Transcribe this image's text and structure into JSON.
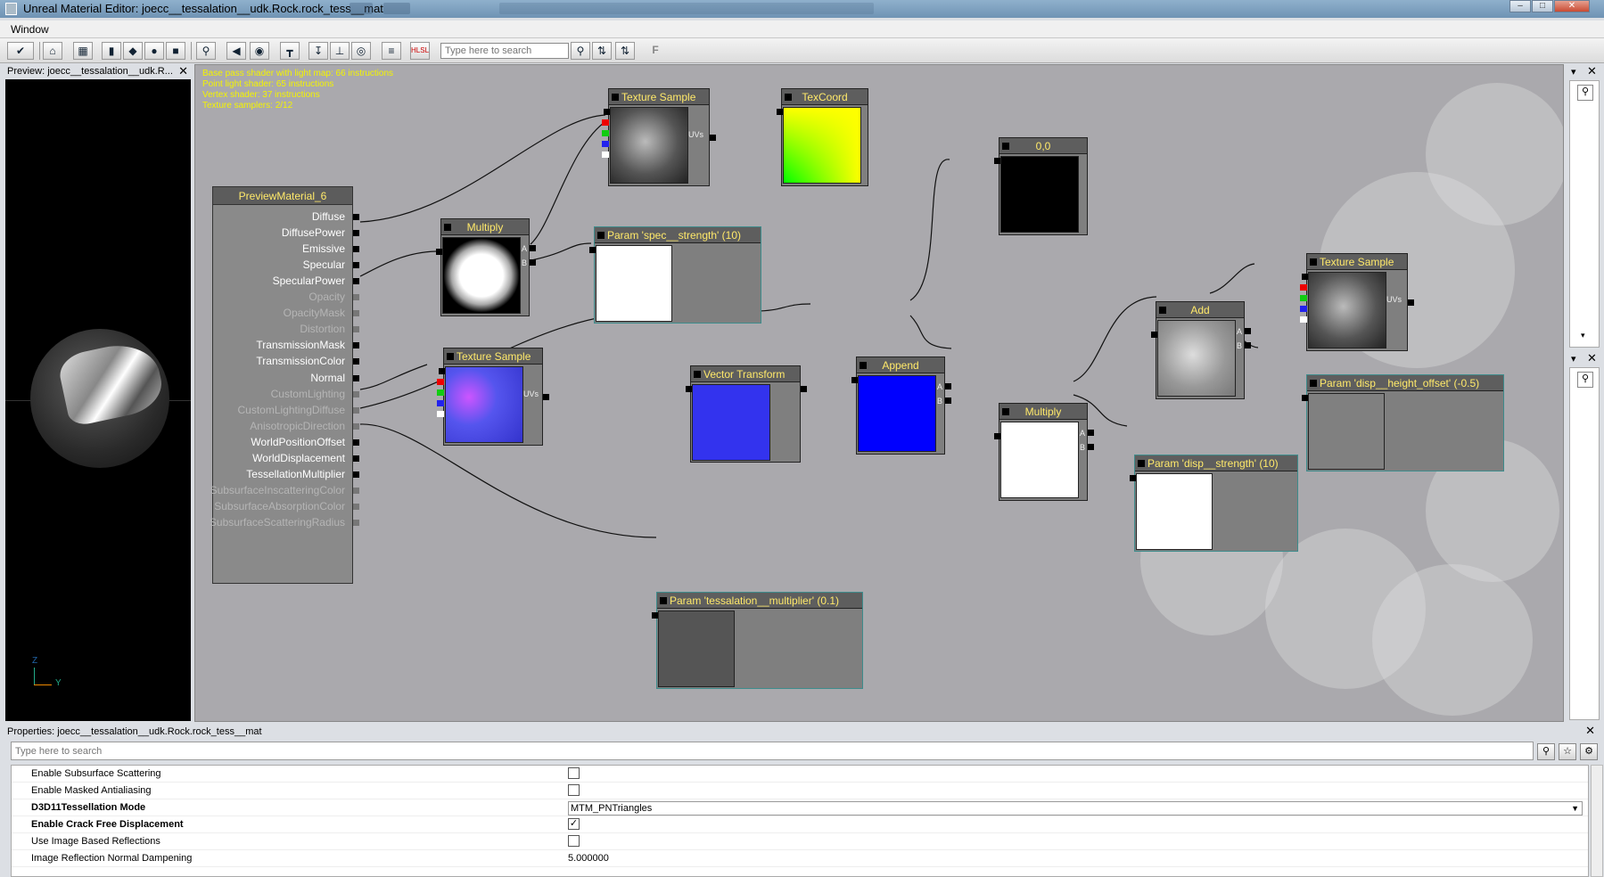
{
  "window": {
    "title": "Unreal Material Editor: joecc__tessalation__udk.Rock.rock_tess__mat",
    "minimize": "–",
    "maximize": "□",
    "close": "✕"
  },
  "menu": {
    "window": "Window"
  },
  "toolbar": {
    "search_placeholder": "Type here to search",
    "icons": [
      "apply",
      "home",
      "grid",
      "cylinder",
      "cube",
      "sphere",
      "plane",
      "zoom",
      "back",
      "realtime",
      "node",
      "stats",
      "fit",
      "clean",
      "hlsl",
      "search-find",
      "search-prev",
      "search-next",
      "font"
    ]
  },
  "preview": {
    "title": "Preview: joecc__tessalation__udk.R...",
    "close": "✕",
    "axis_z": "Z",
    "axis_y": "Y"
  },
  "graph": {
    "stats": [
      "Base pass shader with light map: 66 instructions",
      "Point light shader: 65 instructions",
      "Vertex shader: 37 instructions",
      "Texture samplers: 2/12"
    ],
    "preview_material": {
      "title": "PreviewMaterial_6",
      "inputs": [
        {
          "label": "Diffuse",
          "active": true
        },
        {
          "label": "DiffusePower",
          "active": true
        },
        {
          "label": "Emissive",
          "active": true
        },
        {
          "label": "Specular",
          "active": true
        },
        {
          "label": "SpecularPower",
          "active": true
        },
        {
          "label": "Opacity",
          "active": false
        },
        {
          "label": "OpacityMask",
          "active": false
        },
        {
          "label": "Distortion",
          "active": false
        },
        {
          "label": "TransmissionMask",
          "active": true
        },
        {
          "label": "TransmissionColor",
          "active": true
        },
        {
          "label": "Normal",
          "active": true
        },
        {
          "label": "CustomLighting",
          "active": false
        },
        {
          "label": "CustomLightingDiffuse",
          "active": false
        },
        {
          "label": "AnisotropicDirection",
          "active": false
        },
        {
          "label": "WorldPositionOffset",
          "active": true
        },
        {
          "label": "WorldDisplacement",
          "active": true
        },
        {
          "label": "TessellationMultiplier",
          "active": true
        },
        {
          "label": "SubsurfaceInscatteringColor",
          "active": false
        },
        {
          "label": "SubsurfaceAbsorptionColor",
          "active": false
        },
        {
          "label": "SubsurfaceScatteringRadius",
          "active": false
        }
      ]
    },
    "nodes": {
      "tex1": "Texture Sample",
      "texcoord": "TexCoord",
      "multiply1": "Multiply",
      "spec": "Param 'spec__strength' (10)",
      "tex_normal": "Texture Sample",
      "vtransform": "Vector Transform",
      "append": "Append",
      "const00": "0,0",
      "multiply2": "Multiply",
      "add": "Add",
      "tex3": "Texture Sample",
      "height_offset": "Param 'disp__height_offset' (-0.5)",
      "disp_strength": "Param 'disp__strength' (10)",
      "tess_mult": "Param 'tessalation__multiplier' (0.1)",
      "uvs": "UVs",
      "a": "A",
      "b": "B"
    }
  },
  "properties": {
    "title": "Properties: joecc__tessalation__udk.Rock.rock_tess__mat",
    "close": "✕",
    "search_placeholder": "Type here to search",
    "rows": [
      {
        "label": "Enable Subsurface Scattering",
        "bold": false,
        "type": "checkbox",
        "checked": false
      },
      {
        "label": "Enable Masked Antialiasing",
        "bold": false,
        "type": "checkbox",
        "checked": false
      },
      {
        "label": "D3D11Tessellation Mode",
        "bold": true,
        "type": "combo",
        "value": "MTM_PNTriangles"
      },
      {
        "label": "Enable Crack Free Displacement",
        "bold": true,
        "type": "checkbox",
        "checked": true
      },
      {
        "label": "Use Image Based Reflections",
        "bold": false,
        "type": "checkbox",
        "checked": false
      },
      {
        "label": "Image Reflection Normal Dampening",
        "bold": false,
        "type": "text",
        "value": "5.000000"
      }
    ]
  }
}
